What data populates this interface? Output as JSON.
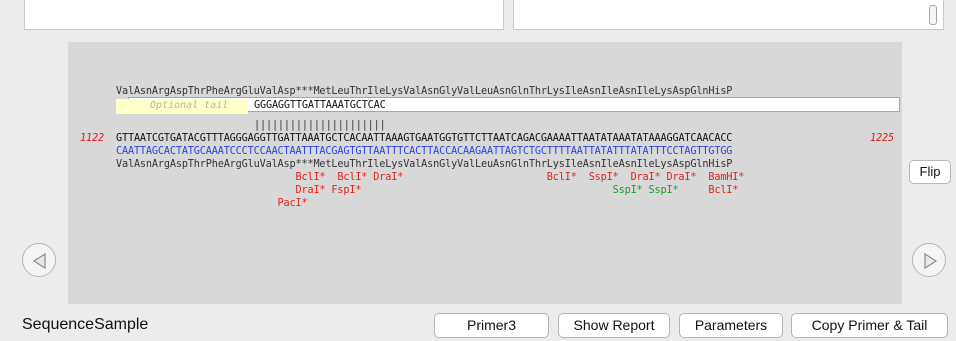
{
  "window": {
    "sequence_name": "SequenceSample"
  },
  "primer_view": {
    "translation_top": "ValAsnArgAspThrPheArgGluValAsp***MetLeuThrIleLysValAsnGlyValLeuAsnGlnThrLysIleAsnIleAsnIleLysAspGlnHisP",
    "tail_placeholder": "Optional tail",
    "tail_value": "GGGAGGTTGATTAAATGCTCAC",
    "match_bars": "||||||||||||||||||||||",
    "start_position": "1122",
    "end_position": "1225",
    "forward_strand": "GTTAATCGTGATACGTTTAGGGAGGTTGATTAAATGCTCACAATTAAAGTGAATGGTGTTCTTAATCAGACGAAAATTAATATAAATATAAAGGATCAACACC",
    "reverse_strand": "CAATTAGCACTATGCAAATCCCTCCAACTAATTTACGAGTGTTAATTTCACTTACCACAAGAATTAGTCTGCTTTTAATTATATTTATATTTCCTAGTTGTGG",
    "translation_bottom": "ValAsnArgAspThrPheArgGluValAsp***MetLeuThrIleLysValAsnGlyValLeuAsnGlnThrLysIleAsnIleAsnIleLysAspGlnHisP",
    "enzyme_rows": [
      [
        {
          "text": "BclI*",
          "col": 30,
          "color": "red"
        },
        {
          "text": "BclI*",
          "col": 37,
          "color": "red"
        },
        {
          "text": "DraI*",
          "col": 43,
          "color": "red"
        },
        {
          "text": "BclI*",
          "col": 72,
          "color": "red"
        },
        {
          "text": "SspI*",
          "col": 79,
          "color": "red"
        },
        {
          "text": "DraI*",
          "col": 86,
          "color": "red"
        },
        {
          "text": "DraI*",
          "col": 92,
          "color": "red"
        },
        {
          "text": "BamHI*",
          "col": 99,
          "color": "red"
        }
      ],
      [
        {
          "text": "DraI*",
          "col": 30,
          "color": "red"
        },
        {
          "text": "FspI*",
          "col": 36,
          "color": "red"
        },
        {
          "text": "SspI*",
          "col": 83,
          "color": "green"
        },
        {
          "text": "SspI*",
          "col": 89,
          "color": "green"
        },
        {
          "text": "BclI*",
          "col": 99,
          "color": "red"
        }
      ],
      [
        {
          "text": "PacI*",
          "col": 27,
          "color": "red"
        }
      ]
    ]
  },
  "buttons": {
    "flip": "Flip",
    "primer3": "Primer3",
    "show_report": "Show Report",
    "parameters": "Parameters",
    "copy_primer_tail": "Copy Primer & Tail"
  },
  "icons": {
    "prev": "left-triangle-icon",
    "next": "right-triangle-icon"
  },
  "colors": {
    "position_labels": "#d8241f",
    "reverse_strand": "#2b45e0",
    "enzyme_red": "#e2231a",
    "enzyme_green": "#1f9a2a"
  }
}
